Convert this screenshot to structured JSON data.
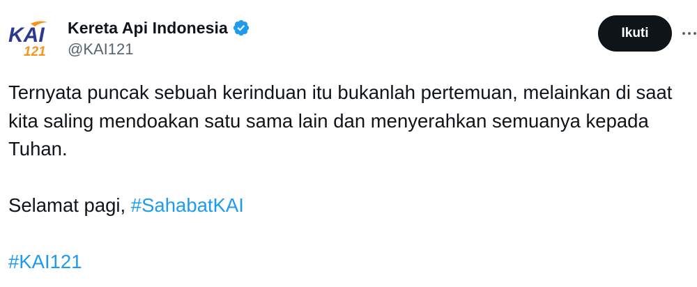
{
  "account": {
    "display_name": "Kereta Api Indonesia",
    "handle": "@KAI121",
    "verified": true,
    "avatar_logo_text": "KAI",
    "avatar_logo_sub": "121"
  },
  "actions": {
    "follow_label": "Ikuti",
    "more_icon": "more-horizontal-icon"
  },
  "tweet": {
    "line1": "Ternyata puncak sebuah kerinduan itu bukanlah pertemuan, melainkan di saat kita saling mendoakan satu sama lain dan menyerahkan semuanya kepada Tuhan.",
    "greeting": "Selamat pagi, ",
    "hashtag_1": "#SahabatKAI",
    "hashtag_2": "#KAI121"
  },
  "colors": {
    "text": "#0f1419",
    "secondary": "#536471",
    "link": "#1d9bf0",
    "verified_badge": "#1d9bf0",
    "logo_blue": "#2b3990",
    "logo_orange": "#f7941d"
  }
}
